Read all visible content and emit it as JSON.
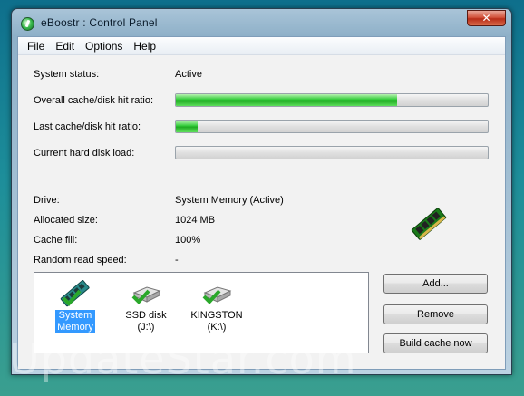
{
  "window": {
    "title": "eBoostr : Control Panel",
    "close_label": "✕"
  },
  "menu": [
    "File",
    "Edit",
    "Options",
    "Help"
  ],
  "status": {
    "system_status_label": "System status:",
    "system_status_value": "Active",
    "overall_ratio_label": "Overall cache/disk hit ratio:",
    "overall_ratio_fraction": 0.71,
    "last_ratio_label": "Last cache/disk hit ratio:",
    "last_ratio_fraction": 0.07,
    "disk_load_label": "Current hard disk load:",
    "disk_load_fraction": 0.0
  },
  "drive_info": {
    "drive_label": "Drive:",
    "drive_value": "System Memory (Active)",
    "allocated_label": "Allocated size:",
    "allocated_value": "1024 MB",
    "cache_fill_label": "Cache fill:",
    "cache_fill_value": "100%",
    "random_read_label": "Random read speed:",
    "random_read_value": "-"
  },
  "drives": [
    {
      "line1": "System",
      "line2": "Memory",
      "icon": "ram-icon"
    },
    {
      "line1": "SSD disk (J:\\)",
      "line2": "",
      "icon": "ssd-icon"
    },
    {
      "line1": "KINGSTON",
      "line2": "(K:\\)",
      "icon": "usb-drive-icon"
    }
  ],
  "buttons": {
    "add": "Add...",
    "remove": "Remove",
    "build": "Build cache now"
  },
  "watermark": "UpdateStar.com",
  "colors": {
    "progress_green": "#33cc3a",
    "selection_blue": "#3399ff"
  }
}
